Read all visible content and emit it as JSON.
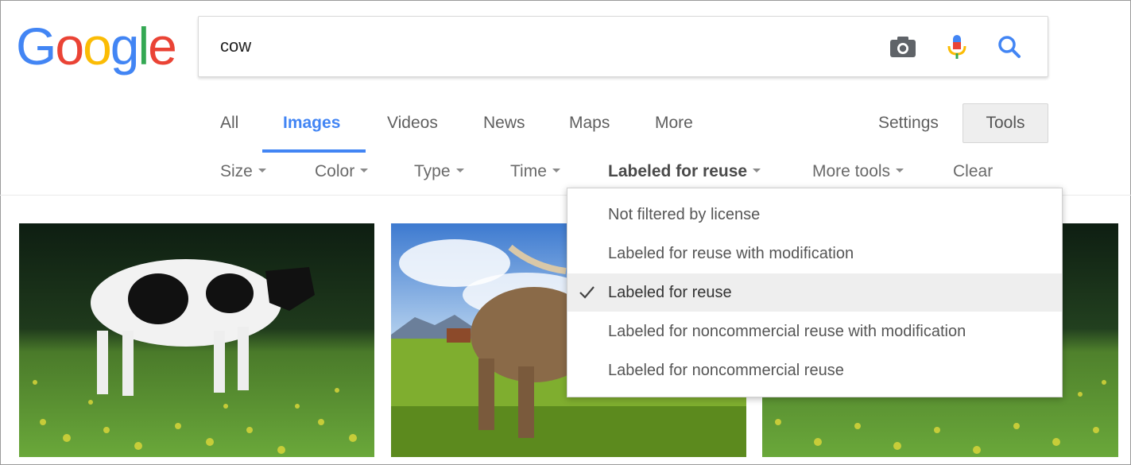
{
  "logo": {
    "letters": [
      "G",
      "o",
      "o",
      "g",
      "l",
      "e"
    ],
    "colors": [
      "#4285F4",
      "#EA4335",
      "#FBBC05",
      "#4285F4",
      "#34A853",
      "#EA4335"
    ]
  },
  "search": {
    "value": "cow",
    "icons": [
      "camera-icon",
      "microphone-icon",
      "search-icon"
    ]
  },
  "tabs": {
    "items": [
      {
        "label": "All"
      },
      {
        "label": "Images",
        "active": true
      },
      {
        "label": "Videos"
      },
      {
        "label": "News"
      },
      {
        "label": "Maps"
      },
      {
        "label": "More"
      }
    ],
    "settings": "Settings",
    "tools": "Tools"
  },
  "toolbar": {
    "size": "Size",
    "color": "Color",
    "type": "Type",
    "time": "Time",
    "license": "Labeled for reuse",
    "more_tools": "More tools",
    "clear": "Clear"
  },
  "license_menu": {
    "options": [
      "Not filtered by license",
      "Labeled for reuse with modification",
      "Labeled for reuse",
      "Labeled for noncommercial reuse with modification",
      "Labeled for noncommercial reuse"
    ],
    "selected_index": 2
  },
  "results": {
    "images": [
      "black-and-white cow in dandelion field",
      "brown horned cow on sunny meadow",
      "cow in dandelion field"
    ]
  },
  "colors": {
    "accent": "#4285F4",
    "tools_bg": "#EEEEEE"
  }
}
